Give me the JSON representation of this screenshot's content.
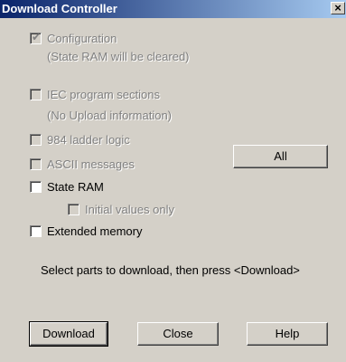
{
  "window": {
    "title": "Download Controller",
    "close_glyph": "×"
  },
  "options": {
    "configuration": {
      "label": "Configuration",
      "note": "(State RAM will be cleared)",
      "checked": true,
      "enabled": false
    },
    "iec_sections": {
      "label": "IEC program sections",
      "note": "(No Upload information)",
      "checked": false,
      "enabled": false
    },
    "ladder_logic": {
      "label": "984 ladder logic",
      "checked": false,
      "enabled": false
    },
    "ascii_messages": {
      "label": "ASCII messages",
      "checked": false,
      "enabled": false
    },
    "state_ram": {
      "label": "State RAM",
      "checked": false,
      "enabled": true
    },
    "initial_values": {
      "label": "Initial values only",
      "checked": false,
      "enabled": false
    },
    "extended_memory": {
      "label": "Extended memory",
      "checked": false,
      "enabled": true
    }
  },
  "instruction": "Select parts to download, then press <Download>",
  "buttons": {
    "all": "All",
    "download": "Download",
    "close": "Close",
    "help": "Help"
  },
  "icons": {
    "check": "check-icon",
    "close": "close-icon"
  },
  "colors": {
    "title_start": "#0a246a",
    "title_end": "#a6caf0",
    "face": "#d4d0c8",
    "disabled_text": "#808080"
  }
}
